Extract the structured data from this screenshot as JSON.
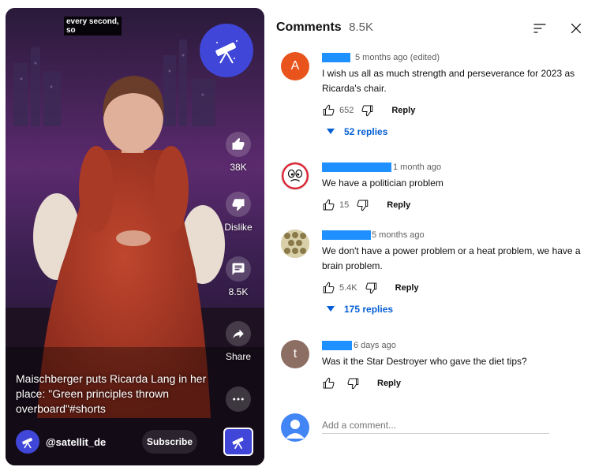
{
  "video": {
    "caption": "every second,\nso",
    "title": "Maischberger puts Ricarda Lang in her place: \"Green principles thrown overboard\"#shorts",
    "channel_handle": "@satellit_de",
    "subscribe_label": "Subscribe",
    "likes": "38K",
    "dislike_label": "Dislike",
    "comments_count": "8.5K",
    "share_label": "Share",
    "channel_icon": "telescope-icon",
    "brand_color": "#3f46d8"
  },
  "comments_panel": {
    "title": "Comments",
    "count": "8.5K",
    "add_placeholder": "Add a comment...",
    "comments": [
      {
        "avatar_letter": "A",
        "avatar_color": "#e8541c",
        "time": "5 months ago (edited)",
        "text": "I wish us all as much strength and perseverance for 2023 as Ricarda's chair.",
        "likes": "652",
        "reply_label": "Reply",
        "replies_label": "52 replies"
      },
      {
        "avatar_letter": "",
        "avatar_color": "#ffffff",
        "time": "1 month ago",
        "text": "We have a politician problem",
        "likes": "15",
        "reply_label": "Reply"
      },
      {
        "avatar_letter": "",
        "avatar_color": "#c8b98a",
        "time": "5 months ago",
        "text": "We don't have a power problem or a heat problem, we have a brain problem.",
        "likes": "5.4K",
        "reply_label": "Reply",
        "replies_label": "175 replies"
      },
      {
        "avatar_letter": "t",
        "avatar_color": "#8d6e63",
        "time": "6 days ago",
        "text": "Was it the Star Destroyer who gave the diet tips?",
        "likes": "",
        "reply_label": "Reply"
      }
    ]
  }
}
